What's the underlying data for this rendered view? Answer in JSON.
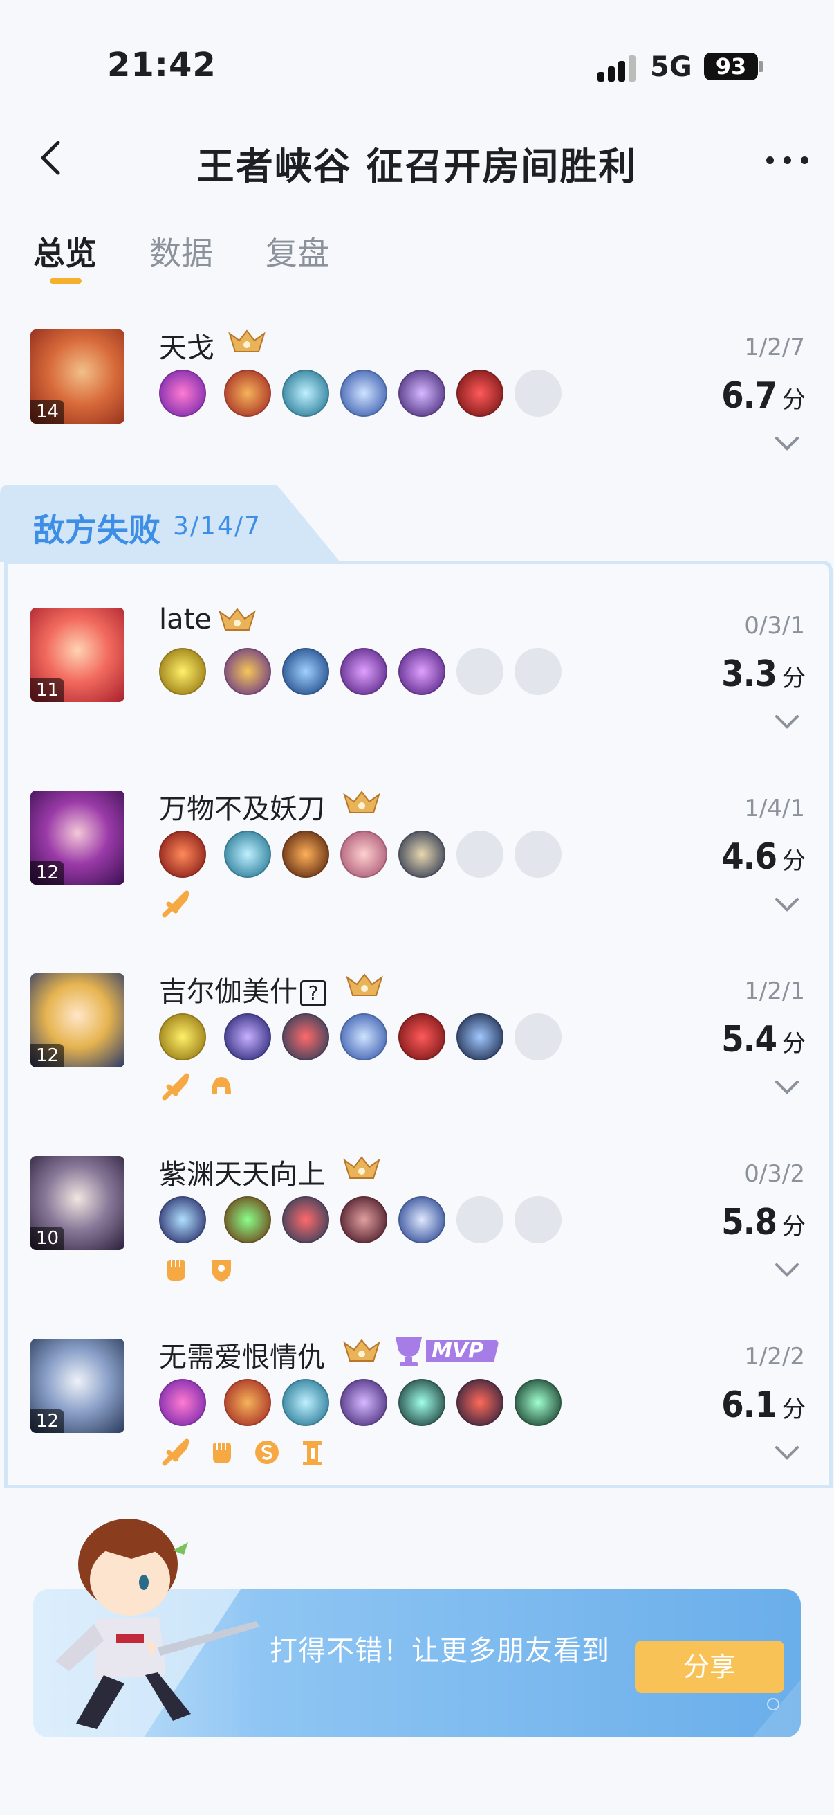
{
  "status_bar": {
    "time": "21:42",
    "network": "5G",
    "battery": "93"
  },
  "header": {
    "title": "王者峡谷 征召开房间胜利"
  },
  "tabs": [
    {
      "label": "总览",
      "active": true
    },
    {
      "label": "数据",
      "active": false
    },
    {
      "label": "复盘",
      "active": false
    }
  ],
  "ally_players": [
    {
      "name": "天戈",
      "level": "14",
      "kda": "1/2/7",
      "score": "6.7",
      "score_unit": "分",
      "items": [
        "purple-slash",
        "red-blade",
        "teal-boots",
        "blue-spear",
        "purple-axe",
        "red-gem",
        "empty"
      ]
    }
  ],
  "enemy_team": {
    "label": "敌方失败",
    "kda": "3/14/7"
  },
  "enemy_players": [
    {
      "name": "late",
      "level": "11",
      "kda": "0/3/1",
      "score": "3.3",
      "score_unit": "分",
      "items": [
        "gold-swirl",
        "gold-mask",
        "blue-boots",
        "purple-hand",
        "purple-hand",
        "empty",
        "empty"
      ],
      "badges": []
    },
    {
      "name": "万物不及妖刀",
      "level": "12",
      "kda": "1/4/1",
      "score": "4.6",
      "score_unit": "分",
      "items": [
        "red-beast",
        "teal-boots",
        "brown-staff",
        "pink-glove",
        "navy-armor",
        "empty",
        "empty"
      ],
      "badges": [
        "sword-badge-icon"
      ]
    },
    {
      "name": "吉尔伽美什",
      "name_suffix": "?",
      "level": "12",
      "kda": "1/2/1",
      "score": "5.4",
      "score_unit": "分",
      "items": [
        "gold-swirl",
        "blue-dagger",
        "red-boots",
        "blue-spear",
        "red-gem",
        "navy-spear",
        "empty"
      ],
      "badges": [
        "sword-badge-icon",
        "helmet-badge-icon"
      ]
    },
    {
      "name": "紫渊天天向上",
      "level": "10",
      "kda": "0/3/2",
      "score": "5.8",
      "score_unit": "分",
      "items": [
        "lightning",
        "green-gem",
        "red-boots",
        "red-claw",
        "blue-shield",
        "empty",
        "empty"
      ],
      "badges": [
        "fist-badge-icon",
        "shield-badge-icon"
      ]
    },
    {
      "name": "无需爱恨情仇",
      "level": "12",
      "kda": "1/2/2",
      "score": "6.1",
      "score_unit": "分",
      "mvp": "MVP",
      "items": [
        "purple-slash",
        "red-blade",
        "teal-boots",
        "purple-axe",
        "teal-sword",
        "red-crystal",
        "green-sword"
      ],
      "badges": [
        "sword-badge-icon",
        "fist-badge-icon",
        "coin-badge-icon",
        "tower-badge-icon"
      ]
    }
  ],
  "share_banner": {
    "text": "打得不错！让更多朋友看到",
    "button": "分享"
  },
  "colors": {
    "accent": "#f5b12e",
    "enemy_blue": "#3d8ee6",
    "badge_orange": "#f6a842"
  }
}
